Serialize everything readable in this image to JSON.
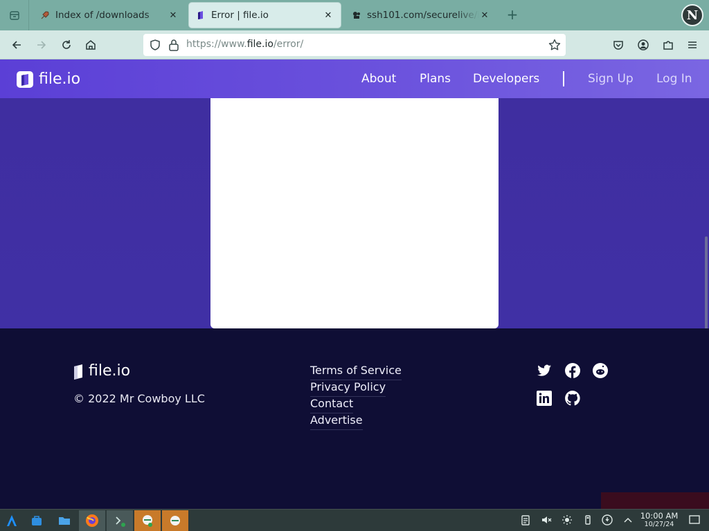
{
  "browser": {
    "tabs": [
      {
        "title": "Index of /downloads",
        "active": false
      },
      {
        "title": "Error | file.io",
        "active": true
      },
      {
        "title": "ssh101.com/securelive/inde",
        "active": false
      }
    ],
    "close_glyph": "✕",
    "new_tab_glyph": "+",
    "profile_initial": "N",
    "url_scheme": "https://www.",
    "url_host": "file.io",
    "url_path": "/error/"
  },
  "site": {
    "brand": "file.io",
    "nav": [
      "About",
      "Plans",
      "Developers"
    ],
    "auth": [
      "Sign Up",
      "Log In"
    ],
    "accent": "#5b3fd6"
  },
  "footer": {
    "brand": "file.io",
    "copyright": "© 2022 Mr Cowboy LLC",
    "links": [
      "Terms of Service",
      "Privacy Policy",
      "Contact",
      "Advertise"
    ],
    "social": [
      "twitter-icon",
      "facebook-icon",
      "reddit-icon",
      "linkedin-icon",
      "github-icon"
    ]
  },
  "taskbar": {
    "time": "10:00 AM",
    "date": "10/27/24"
  }
}
